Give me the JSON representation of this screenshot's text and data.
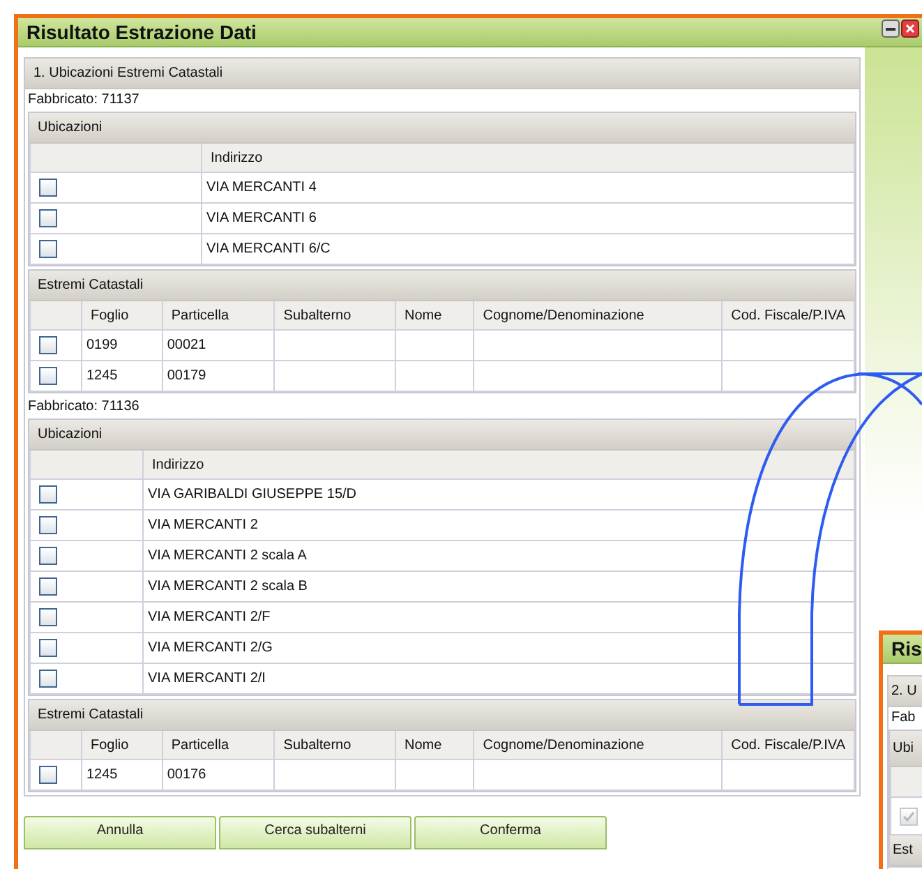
{
  "window": {
    "title": "Risultato Estrazione Dati"
  },
  "section": {
    "title": "1. Ubicazioni Estremi Catastali"
  },
  "fabbricati": [
    {
      "label": "Fabbricato: 71137",
      "ubicazioni": {
        "title": "Ubicazioni",
        "column": "Indirizzo",
        "rows": [
          {
            "address": "VIA MERCANTI 4",
            "checked": false
          },
          {
            "address": "VIA MERCANTI 6",
            "checked": false
          },
          {
            "address": "VIA MERCANTI 6/C",
            "checked": false
          }
        ]
      },
      "estremi": {
        "title": "Estremi Catastali",
        "columns": [
          "Foglio",
          "Particella",
          "Subalterno",
          "Nome",
          "Cognome/Denominazione",
          "Cod. Fiscale/P.IVA"
        ],
        "rows": [
          {
            "checked": false,
            "foglio": "0199",
            "particella": "00021"
          },
          {
            "checked": false,
            "foglio": "1245",
            "particella": "00179"
          }
        ]
      }
    },
    {
      "label": "Fabbricato: 71136",
      "ubicazioni": {
        "title": "Ubicazioni",
        "column": "Indirizzo",
        "rows": [
          {
            "address": "VIA GARIBALDI GIUSEPPE 15/D",
            "checked": false
          },
          {
            "address": "VIA MERCANTI 2",
            "checked": false
          },
          {
            "address": "VIA MERCANTI 2 scala A",
            "checked": false
          },
          {
            "address": "VIA MERCANTI 2 scala B",
            "checked": false
          },
          {
            "address": "VIA MERCANTI 2/F",
            "checked": false
          },
          {
            "address": "VIA MERCANTI 2/G",
            "checked": false
          },
          {
            "address": "VIA MERCANTI 2/I",
            "checked": false
          }
        ]
      },
      "estremi": {
        "title": "Estremi Catastali",
        "columns": [
          "Foglio",
          "Particella",
          "Subalterno",
          "Nome",
          "Cognome/Denominazione",
          "Cod. Fiscale/P.IVA"
        ],
        "rows": [
          {
            "checked": false,
            "foglio": "1245",
            "particella": "00176"
          }
        ]
      }
    }
  ],
  "buttons": [
    {
      "label": "Annulla"
    },
    {
      "label": "Cerca subalterni"
    },
    {
      "label": "Conferma"
    }
  ],
  "second_window": {
    "title": "Ris",
    "section": "2. U",
    "fabbricato": "Fab",
    "ubicazioni": "Ubi",
    "row": {
      "checked": true,
      "disabled": true
    },
    "estremi": "Est"
  }
}
